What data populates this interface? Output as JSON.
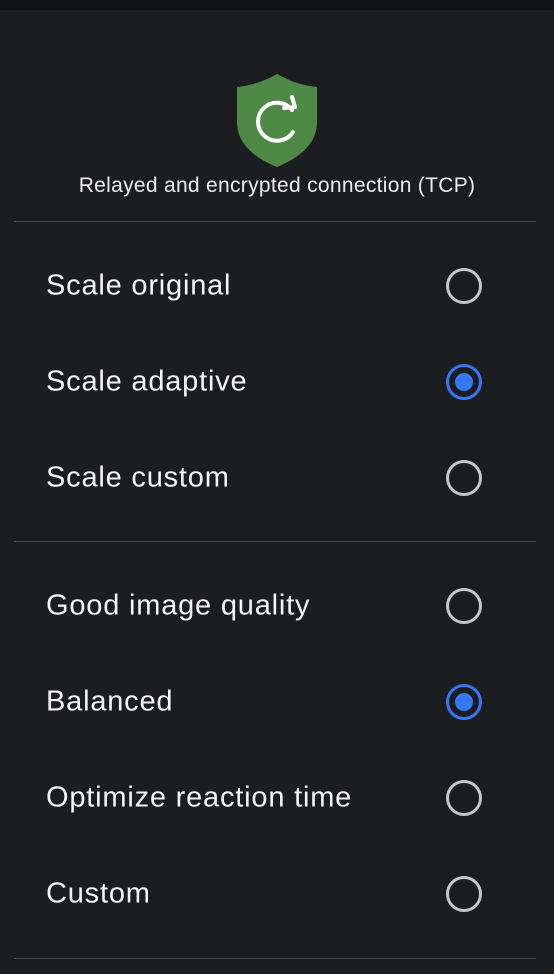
{
  "connection": {
    "status_text": "Relayed and encrypted connection (TCP)",
    "icon": "shield-refresh-icon",
    "shield_color": "#4e8a45"
  },
  "scale_group": {
    "options": [
      {
        "label": "Scale original",
        "selected": false
      },
      {
        "label": "Scale adaptive",
        "selected": true
      },
      {
        "label": "Scale custom",
        "selected": false
      }
    ]
  },
  "quality_group": {
    "options": [
      {
        "label": "Good image quality",
        "selected": false
      },
      {
        "label": "Balanced",
        "selected": true
      },
      {
        "label": "Optimize reaction time",
        "selected": false
      },
      {
        "label": "Custom",
        "selected": false
      }
    ]
  },
  "colors": {
    "background": "#1c1d21",
    "accent": "#3478f6"
  }
}
